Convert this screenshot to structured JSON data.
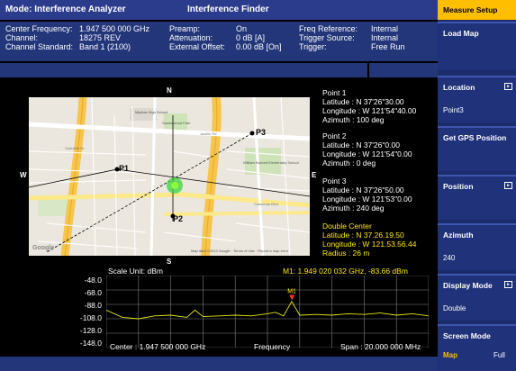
{
  "title_bar": {
    "mode": "Mode: Interference Analyzer",
    "app": "Interference Finder"
  },
  "info": {
    "center_frequency_label": "Center Frequency:",
    "center_frequency_value": "1.947 500 000 GHz",
    "channel_label": "Channel:",
    "channel_value": "18275 REV",
    "channel_standard_label": "Channel Standard:",
    "channel_standard_value": "Band 1 (2100)",
    "preamp_label": "Preamp:",
    "preamp_value": "On",
    "attenuation_label": "Attenuation:",
    "attenuation_value": "0 dB  [A]",
    "external_offset_label": "External Offset:",
    "external_offset_value": "0.00 dB  [On]",
    "freq_reference_label": "Freq Reference:",
    "freq_reference_value": "Internal",
    "trigger_source_label": "Trigger Source:",
    "trigger_source_value": "Internal",
    "trigger_label": "Trigger:",
    "trigger_value": "Free Run"
  },
  "map": {
    "directions": {
      "n": "N",
      "s": "S",
      "e": "E",
      "w": "W"
    },
    "labels": {
      "p1": "P1",
      "p2": "P2",
      "p3": "P3"
    },
    "attribution": "Map data ©2013 Google · Terms of Use · Report a map error",
    "google": "Google",
    "roads": [
      "Yosemite Dr",
      "Jacklin Rd",
      "Sandalwood Park",
      "Calaveras Blvd",
      "Milpitas High School",
      "William Burnett Elementary School"
    ]
  },
  "points": [
    {
      "title": "Point 1",
      "latitude": "Latitude : N 37'26\"30.00",
      "longitude": "Longitude : W 121'54\"40.00",
      "azimuth": "Azimuth : 100 deg"
    },
    {
      "title": "Point 2",
      "latitude": "Latitude : N 37'26\"0.00",
      "longitude": "Longitude : W 121'54\"0.00",
      "azimuth": "Azimuth : 0 deg"
    },
    {
      "title": "Point 3",
      "latitude": "Latitude : N 37'26\"50.00",
      "longitude": "Longitude : W 121'53\"0.00",
      "azimuth": "Azimuth : 240 deg"
    }
  ],
  "double_center": {
    "title": "Double Center",
    "latitude": "Latitude : N 37.26.19.50",
    "longitude": "Longitude : W 121.53.56.44",
    "radius": "Radius : 26 m"
  },
  "spectrum": {
    "scale_unit": "Scale Unit: dBm",
    "marker_readout": "M1: 1.949 020 032 GHz, -83.66 dBm",
    "marker_label": "M1",
    "center_label": "Center : 1.947 500 000 GHz",
    "x_label": "Frequency",
    "span_label": "Span : 20.000 000 MHz",
    "y_ticks": [
      "-48.0",
      "-68.0",
      "-88.0",
      "-108.0",
      "-128.0",
      "-148.0"
    ],
    "colors": {
      "trace": "#e6e600",
      "grid": "#7f7f7f",
      "marker": "#ff3030"
    }
  },
  "chart_data": {
    "type": "line",
    "title": "",
    "xlabel": "Frequency",
    "ylabel": "Scale Unit: dBm",
    "xlim": [
      1.9375,
      1.9575
    ],
    "ylim": [
      -148.0,
      -48.0
    ],
    "x_unit": "GHz",
    "y_unit": "dBm",
    "series": [
      {
        "x": [
          1.9375,
          1.9385,
          1.9395,
          1.9405,
          1.9415,
          1.9425,
          1.943,
          1.9435,
          1.9445,
          1.9455,
          1.9465,
          1.9475,
          1.948,
          1.9485,
          1.949,
          1.9495,
          1.9505,
          1.9515,
          1.9525,
          1.9535,
          1.9545,
          1.9555,
          1.9565,
          1.9575
        ],
        "y": [
          -96,
          -106,
          -108,
          -104,
          -103,
          -106,
          -96,
          -105,
          -104,
          -103,
          -104,
          -101,
          -99,
          -104,
          -84,
          -103,
          -102,
          -103,
          -101,
          -102,
          -100,
          -103,
          -101,
          -104
        ]
      }
    ],
    "marker": {
      "name": "M1",
      "x": 1.94902,
      "y": -83.66
    }
  },
  "softkeys": {
    "measure_setup": "Measure Setup",
    "load_map": "Load Map",
    "location": "Location",
    "location_value": "Point3",
    "get_gps": "Get GPS Position",
    "position": "Position",
    "azimuth": "Azimuth",
    "azimuth_value": "240",
    "display_mode": "Display Mode",
    "display_mode_value": "Double",
    "screen_mode": "Screen Mode",
    "screen_mode_map": "Map",
    "screen_mode_full": "Full"
  }
}
